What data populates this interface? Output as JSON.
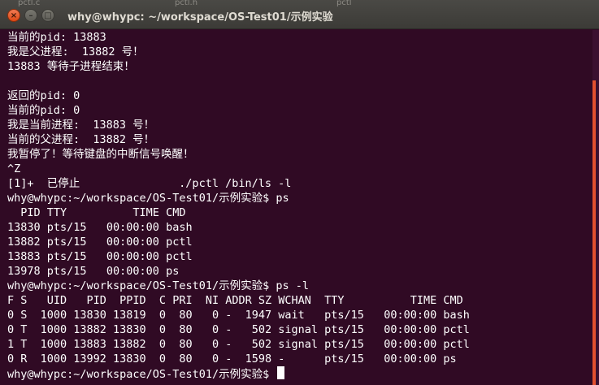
{
  "window": {
    "title": "why@whypc: ~/workspace/OS-Test01/示例实验",
    "background_tabs": [
      "pctl.c",
      "pctl.h",
      "pctl"
    ]
  },
  "colors": {
    "terminal_bg": "#300a24",
    "terminal_fg": "#ffffff",
    "titlebar_bg": "#3c3b37",
    "close_button": "#dd4814",
    "scroll_thumb": "#e2502f"
  },
  "icons": {
    "close": "close-icon",
    "minimize": "minimize-icon",
    "maximize": "maximize-icon"
  },
  "window_buttons": {
    "close": "×",
    "minimize": "–",
    "maximize": "□"
  },
  "terminal": {
    "lines": [
      "当前的pid: 13883",
      "我是父进程:  13882 号！",
      "13883 等待子进程结束！",
      "",
      "返回的pid: 0",
      "当前的pid: 0",
      "我是当前进程:  13883 号！",
      "当前的父进程:  13882 号！",
      "我暂停了！等待键盘的中断信号唤醒！",
      "^Z",
      "[1]+  已停止               ./pctl /bin/ls -l",
      "why@whypc:~/workspace/OS-Test01/示例实验$ ps",
      "  PID TTY          TIME CMD",
      "13830 pts/15   00:00:00 bash",
      "13882 pts/15   00:00:00 pctl",
      "13883 pts/15   00:00:00 pctl",
      "13978 pts/15   00:00:00 ps",
      "why@whypc:~/workspace/OS-Test01/示例实验$ ps -l",
      "F S   UID   PID  PPID  C PRI  NI ADDR SZ WCHAN  TTY          TIME CMD",
      "0 S  1000 13830 13819  0  80   0 -  1947 wait   pts/15   00:00:00 bash",
      "0 T  1000 13882 13830  0  80   0 -   502 signal pts/15   00:00:00 pctl",
      "1 T  1000 13883 13882  0  80   0 -   502 signal pts/15   00:00:00 pctl",
      "0 R  1000 13992 13830  0  80   0 -  1598 -      pts/15   00:00:00 ps"
    ],
    "prompt": "why@whypc:~/workspace/OS-Test01/示例实验$ "
  }
}
